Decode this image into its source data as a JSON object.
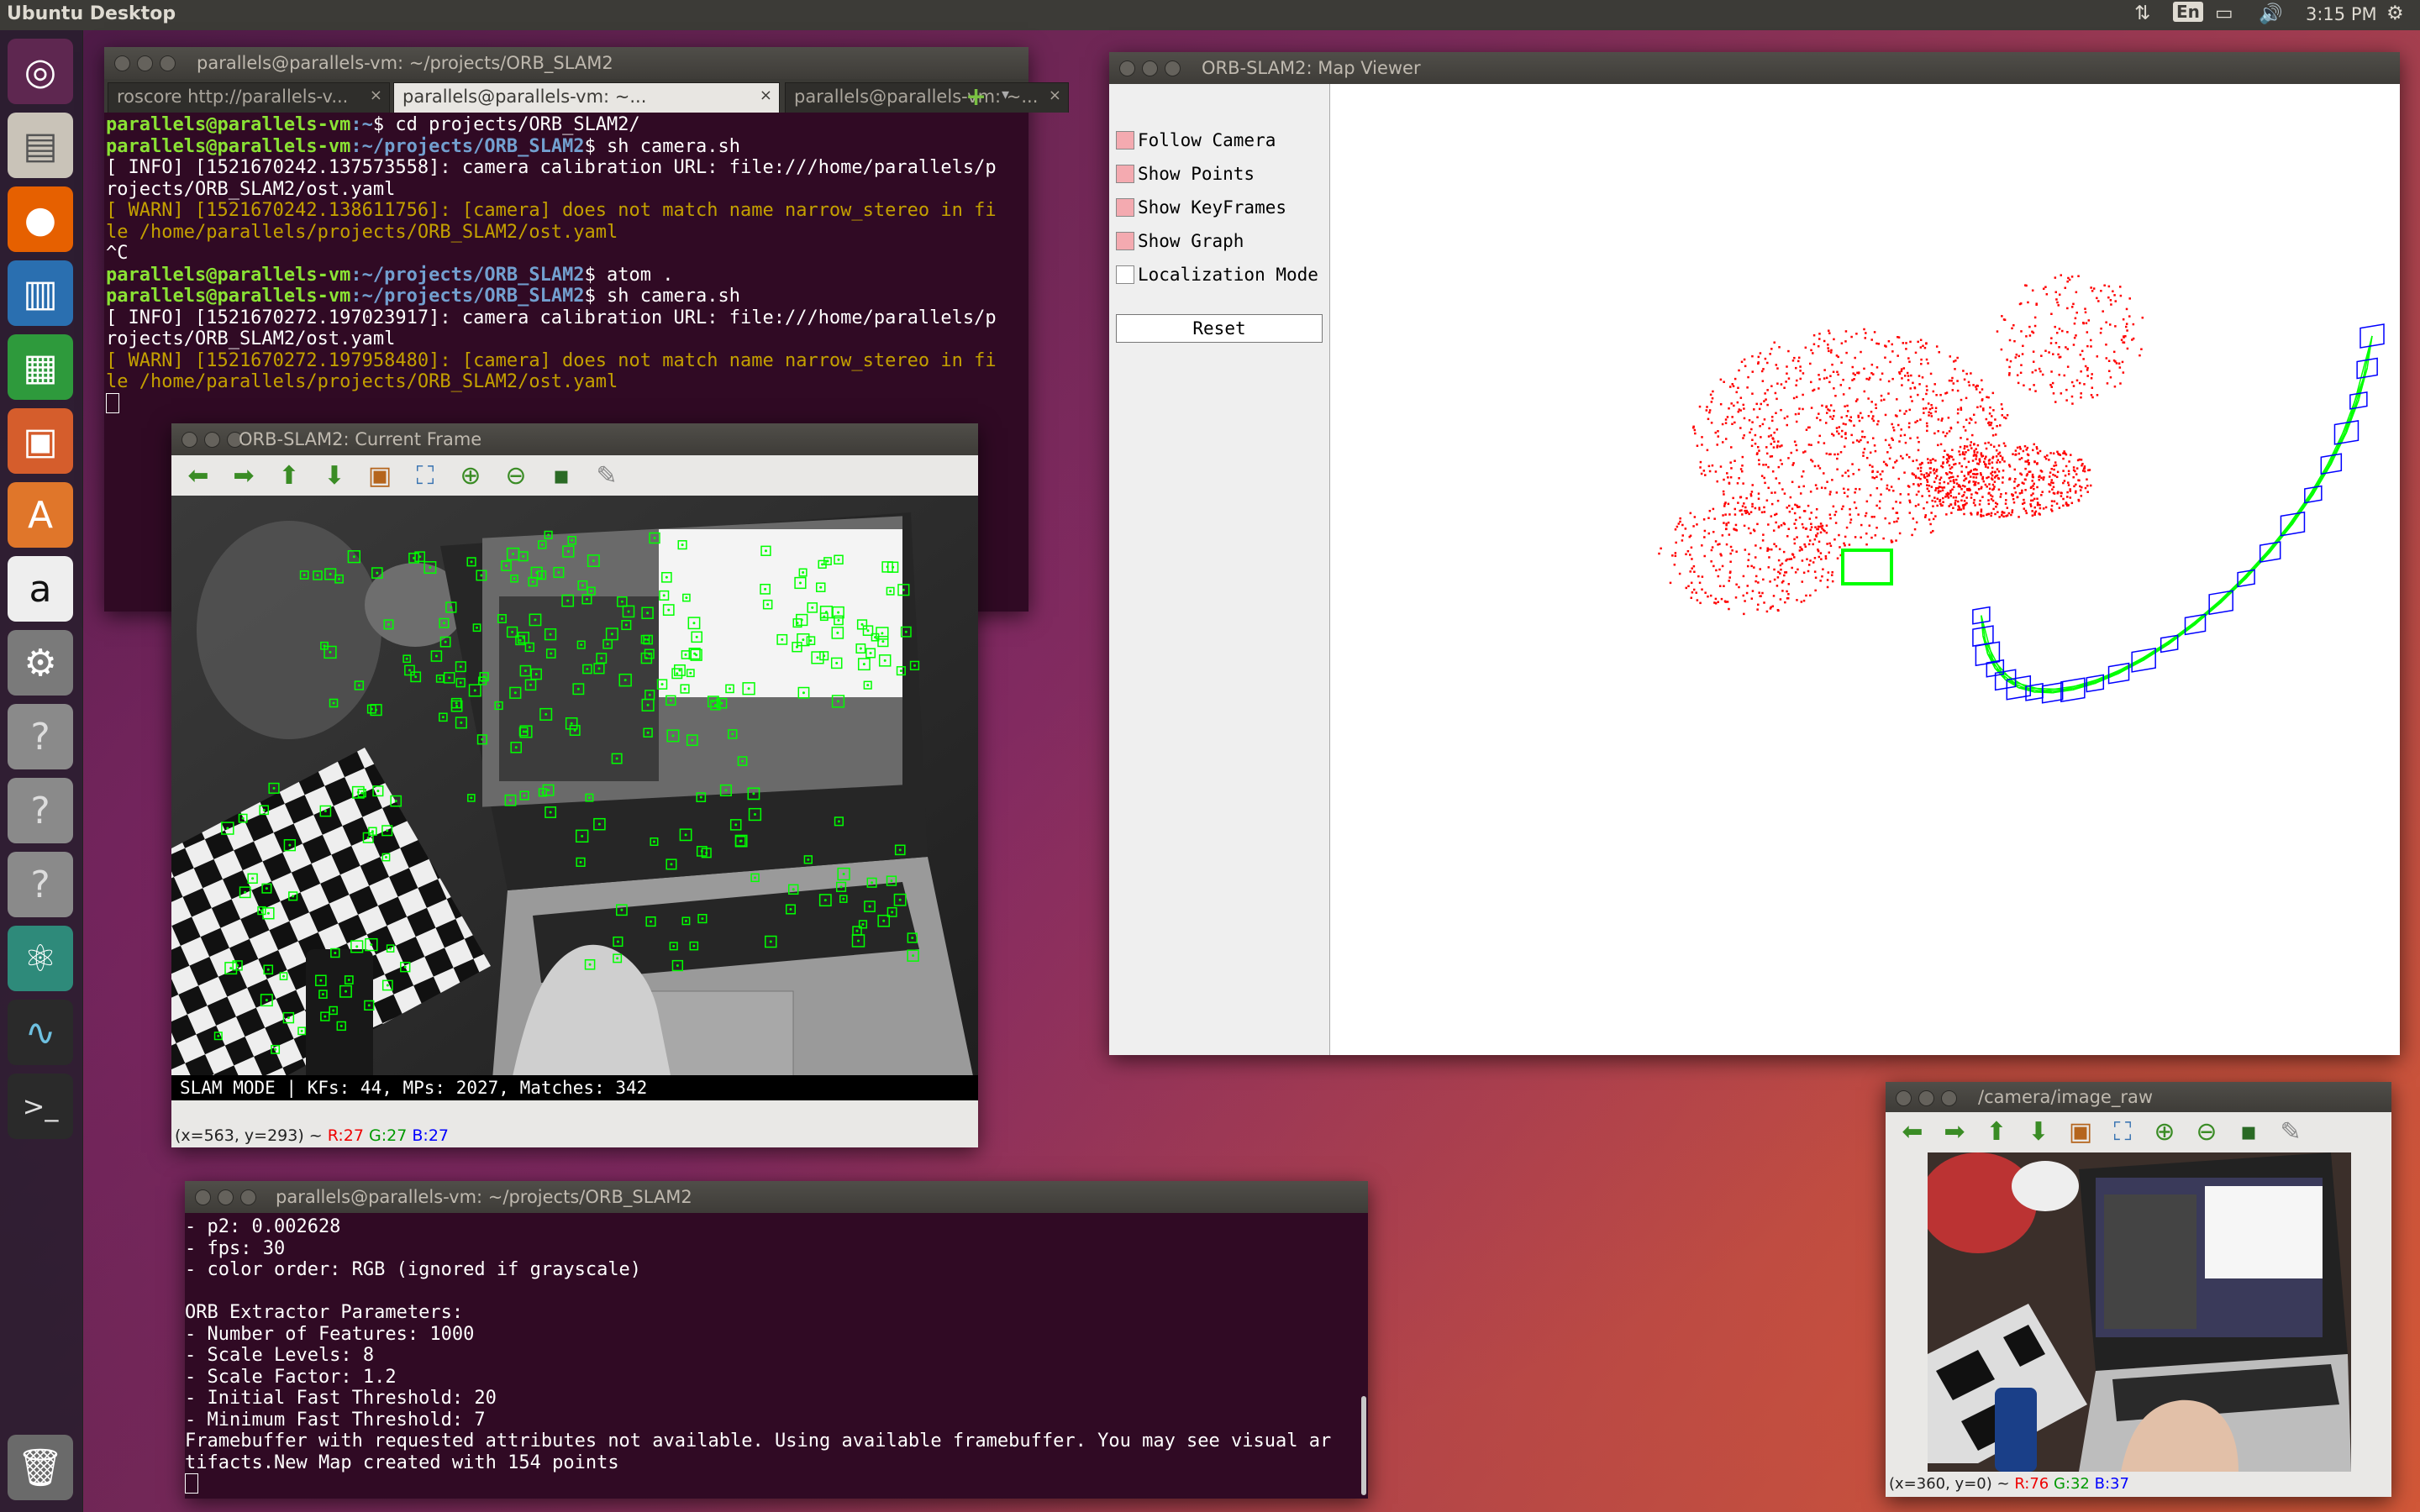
{
  "topbar": {
    "title": "Ubuntu Desktop",
    "keyboard": "En",
    "time": "3:15 PM"
  },
  "launcher": {
    "items": [
      "ubuntu-dash-icon",
      "files-icon",
      "firefox-icon",
      "writer-icon",
      "calc-icon",
      "impress-icon",
      "software-center-icon",
      "amazon-icon",
      "system-settings-icon",
      "unknown-app-icon",
      "unknown-app-icon",
      "unknown-app-icon",
      "atom-icon",
      "system-monitor-icon",
      "terminal-icon",
      "trash-icon"
    ]
  },
  "terminal_top": {
    "title": "parallels@parallels-vm: ~/projects/ORB_SLAM2",
    "tabs": [
      "roscore http://parallels-v...",
      "parallels@parallels-vm: ~...",
      "parallels@parallels-vm: ~..."
    ],
    "active_tab": 1,
    "lines": [
      {
        "type": "prompt",
        "user": "parallels@parallels-vm",
        "path": ":~",
        "cmd": "$ cd projects/ORB_SLAM2/"
      },
      {
        "type": "prompt",
        "user": "parallels@parallels-vm",
        "path": ":~/projects/ORB_SLAM2",
        "cmd": "$ sh camera.sh"
      },
      {
        "type": "text",
        "text": "[ INFO] [1521670242.137573558]: camera calibration URL: file:///home/parallels/p"
      },
      {
        "type": "text",
        "text": "rojects/ORB_SLAM2/ost.yaml"
      },
      {
        "type": "warn",
        "text": "[ WARN] [1521670242.138611756]: [camera] does not match name narrow_stereo in fi"
      },
      {
        "type": "warn",
        "text": "le /home/parallels/projects/ORB_SLAM2/ost.yaml"
      },
      {
        "type": "text",
        "text": "^C"
      },
      {
        "type": "prompt",
        "user": "parallels@parallels-vm",
        "path": ":~/projects/ORB_SLAM2",
        "cmd": "$ atom ."
      },
      {
        "type": "prompt",
        "user": "parallels@parallels-vm",
        "path": ":~/projects/ORB_SLAM2",
        "cmd": "$ sh camera.sh"
      },
      {
        "type": "text",
        "text": "[ INFO] [1521670272.197023917]: camera calibration URL: file:///home/parallels/p"
      },
      {
        "type": "text",
        "text": "rojects/ORB_SLAM2/ost.yaml"
      },
      {
        "type": "warn",
        "text": "[ WARN] [1521670272.197958480]: [camera] does not match name narrow_stereo in fi"
      },
      {
        "type": "warn",
        "text": "le /home/parallels/projects/ORB_SLAM2/ost.yaml"
      },
      {
        "type": "cursor",
        "text": ""
      }
    ]
  },
  "current_frame": {
    "title": "ORB-SLAM2: Current Frame",
    "toolbar": [
      "arrow-left-icon",
      "arrow-right-icon",
      "arrow-up-icon",
      "arrow-down-icon",
      "image-icon",
      "fit-icon",
      "zoom-in-icon",
      "zoom-out-icon",
      "save-icon",
      "brush-icon"
    ],
    "overlay_text": "SLAM MODE |  KFs: 44, MPs: 2027, Matches: 342",
    "coords": "(x=563, y=293) ~",
    "r": "R:27",
    "g": "G:27",
    "b": "B:27"
  },
  "map_viewer": {
    "title": "ORB-SLAM2: Map Viewer",
    "options": [
      {
        "label": "Follow Camera",
        "checked": true
      },
      {
        "label": "Show Points",
        "checked": true
      },
      {
        "label": "Show KeyFrames",
        "checked": true
      },
      {
        "label": "Show Graph",
        "checked": true
      },
      {
        "label": "Localization Mode",
        "checked": false
      }
    ],
    "reset_label": "Reset",
    "colors": {
      "points": "#ff0000",
      "keyframes": "#0000ff",
      "graph": "#00ff00"
    }
  },
  "terminal_bottom": {
    "title": "parallels@parallels-vm: ~/projects/ORB_SLAM2",
    "lines": [
      "- p2: 0.002628",
      "- fps: 30",
      "- color order: RGB (ignored if grayscale)",
      "",
      "ORB Extractor Parameters:",
      "- Number of Features: 1000",
      "- Scale Levels: 8",
      "- Scale Factor: 1.2",
      "- Initial Fast Threshold: 20",
      "- Minimum Fast Threshold: 7",
      "Framebuffer with requested attributes not available. Using available framebuffer. You may see visual ar",
      "tifacts.New Map created with 154 points"
    ]
  },
  "image_raw": {
    "title": "/camera/image_raw",
    "coords": "(x=360, y=0) ~",
    "r": "R:76",
    "g": "G:32",
    "b": "B:37"
  }
}
